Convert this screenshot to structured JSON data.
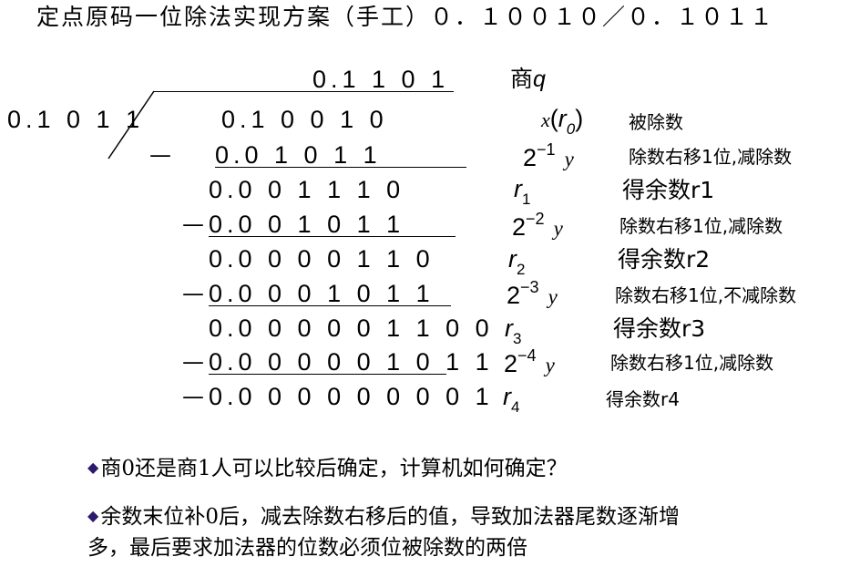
{
  "title": "定点原码一位除法实现方案（手工）０．１００１０／０．１０１１",
  "quotient": {
    "digits": "0.1 1 0 1",
    "label": "商",
    "symbol": "q"
  },
  "divisor": "0.1 0 1 1",
  "rows": [
    {
      "minus": "",
      "digits": "0.1 0 0 1 0",
      "sym_main": "x",
      "sym_paren_open": "(",
      "sym_sub_base": "r",
      "sym_sub_index": "0",
      "sym_paren_close": ")",
      "note": "被除数",
      "note_style": "small"
    },
    {
      "minus": "—",
      "digits": "0.0 1 0 1 1",
      "sym_base": "2",
      "sym_exp": "−1",
      "sym_var": "y",
      "note": "除数右移1位,减除数",
      "note_style": "small"
    },
    {
      "minus": "",
      "digits": "0.0 0 1 1 1 0",
      "sym_base": "r",
      "sym_sub": "1",
      "note": "得余数r1",
      "note_style": "big"
    },
    {
      "minus": "—",
      "digits": "0.0 0 1 0 1 1",
      "sym_base": "2",
      "sym_exp": "−2",
      "sym_var": "y",
      "note": "除数右移1位,减除数",
      "note_style": "small"
    },
    {
      "minus": "",
      "digits": "0.0 0 0 0 1 1 0",
      "sym_base": "r",
      "sym_sub": "2",
      "note": "得余数r2",
      "note_style": "big"
    },
    {
      "minus": "—",
      "digits": "0.0 0 0 1 0 1 1",
      "sym_base": "2",
      "sym_exp": "−3",
      "sym_var": "y",
      "note": "除数右移1位,不减除数",
      "note_style": "small"
    },
    {
      "minus": "",
      "digits": "0.0 0 0 0 0 1 1 0 0",
      "sym_base": "r",
      "sym_sub": "3",
      "note": "得余数r3",
      "note_style": "big"
    },
    {
      "minus": "—",
      "digits": "0.0 0 0 0 0 1 0 1 1",
      "sym_base": "2",
      "sym_exp": "−4",
      "sym_var": "y",
      "note": "除数右移1位,减除数",
      "note_style": "small"
    },
    {
      "minus": "—",
      "digits": "0.0 0 0 0 0 0 0 0 1",
      "sym_base": "r",
      "sym_sub": "4",
      "note": "得余数r4",
      "note_style": "small"
    }
  ],
  "bullets": [
    "商0还是商1人可以比较后确定，计算机如何确定？",
    "余数末位补0后，减去除数右移后的值，导致加法器尾数逐渐增",
    "多，最后要求加法器的位数必须位被除数的两倍"
  ],
  "colors": {
    "bullet": "#2b1a6e",
    "text": "#000000"
  },
  "icons": {
    "bullet": "diamond-icon"
  }
}
